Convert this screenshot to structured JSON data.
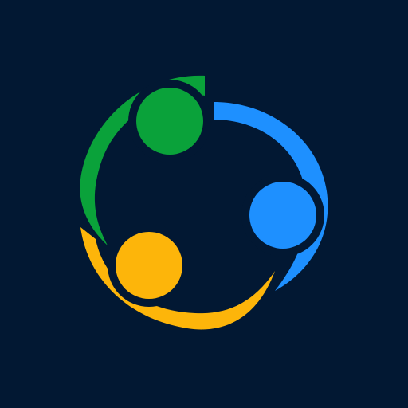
{
  "icon": {
    "name": "three-people-circle-logo",
    "colors": {
      "background": "#021833",
      "green": "#0aa23a",
      "blue": "#1e90ff",
      "yellow": "#fdb50a",
      "outline": "#021833"
    }
  }
}
